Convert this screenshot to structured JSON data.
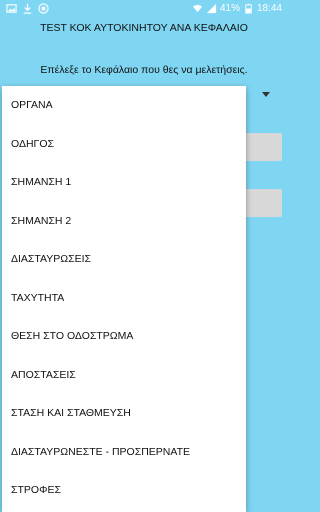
{
  "status_bar": {
    "battery_percent": "41%",
    "time": "18:44",
    "left_icons": [
      "image-icon",
      "download-icon",
      "app-icon"
    ],
    "right_icons": [
      "wifi-icon",
      "signal-icon"
    ]
  },
  "app": {
    "title": "TEST ΚΟΚ ΑΥΤΟΚΙΝΗΤΟΥ ΑΝΑ ΚΕΦΑΛΑΙΟ",
    "prompt": "Επέλεξε το Κεφάλαιο που θες να μελετήσεις."
  },
  "dropdown": {
    "items": [
      "ΟΡΓΑΝΑ",
      "ΟΔΗΓΟΣ",
      "ΣΗΜΑΝΣΗ 1",
      "ΣΗΜΑΝΣΗ 2",
      "ΔΙΑΣΤΑΥΡΩΣΕΙΣ",
      "ΤΑΧΥΤΗΤΑ",
      "ΘΕΣΗ ΣΤΟ ΟΔΟΣΤΡΩΜΑ",
      "ΑΠΟΣΤΑΣΕΙΣ",
      "ΣΤΑΣΗ ΚΑΙ ΣΤΑΘΜΕΥΣΗ",
      "ΔΙΑΣΤΑΥΡΩΝΕΣΤΕ - ΠΡΟΣΠΕΡΝΑΤΕ",
      "ΣΤΡΟΦΕΣ"
    ]
  },
  "colors": {
    "background": "#7fd6f2",
    "dropdown_bg": "#ffffff"
  }
}
